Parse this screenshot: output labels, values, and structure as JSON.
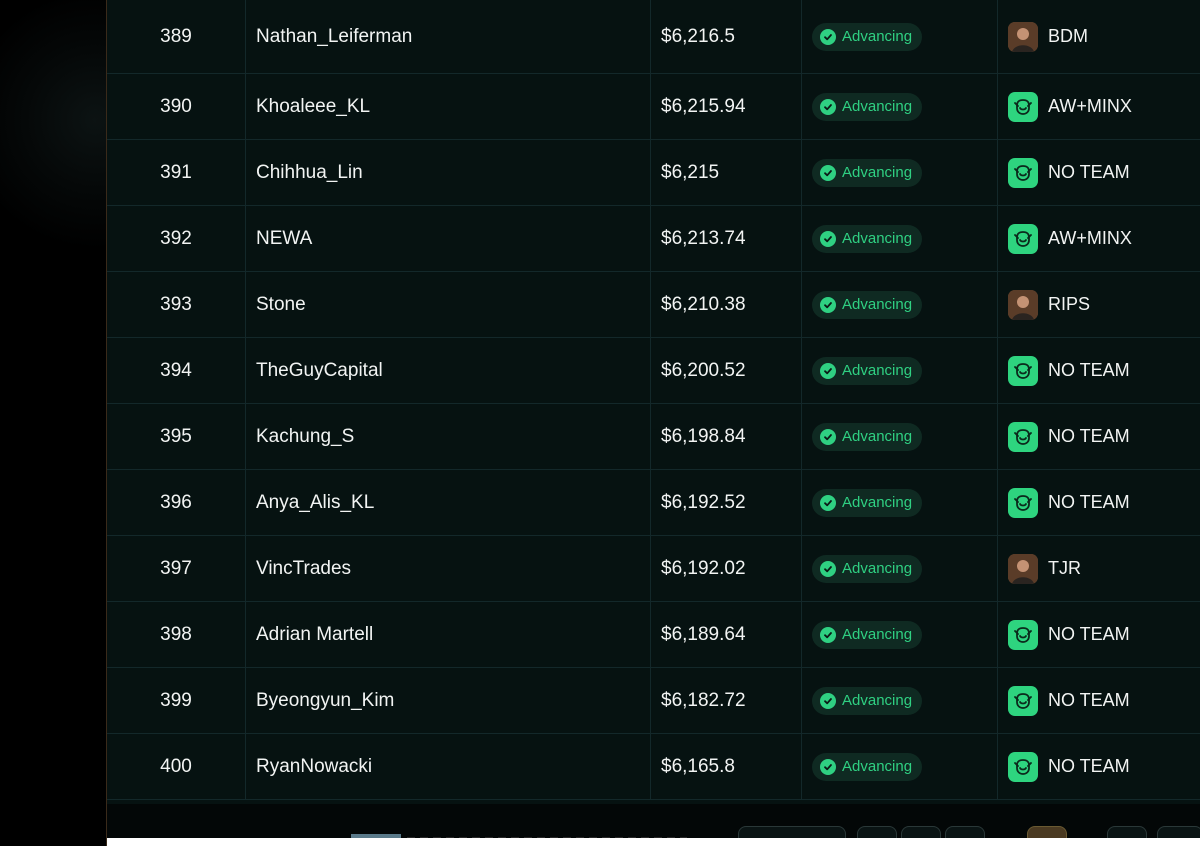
{
  "rows": [
    {
      "rank": "389",
      "name": "Nathan_Leiferman",
      "amount": "$6,216.5",
      "status": "Advancing",
      "team": "BDM",
      "team_icon": "avatar-icon"
    },
    {
      "rank": "390",
      "name": "Khoaleee_KL",
      "amount": "$6,215.94",
      "status": "Advancing",
      "team": "AW+MINX",
      "team_icon": "hand-logo-icon"
    },
    {
      "rank": "391",
      "name": "Chihhua_Lin",
      "amount": "$6,215",
      "status": "Advancing",
      "team": "NO TEAM",
      "team_icon": "hand-logo-icon"
    },
    {
      "rank": "392",
      "name": "NEWA",
      "amount": "$6,213.74",
      "status": "Advancing",
      "team": "AW+MINX",
      "team_icon": "hand-logo-icon"
    },
    {
      "rank": "393",
      "name": "Stone",
      "amount": "$6,210.38",
      "status": "Advancing",
      "team": "RIPS",
      "team_icon": "avatar-icon"
    },
    {
      "rank": "394",
      "name": "TheGuyCapital",
      "amount": "$6,200.52",
      "status": "Advancing",
      "team": "NO TEAM",
      "team_icon": "hand-logo-icon"
    },
    {
      "rank": "395",
      "name": "Kachung_S",
      "amount": "$6,198.84",
      "status": "Advancing",
      "team": "NO TEAM",
      "team_icon": "hand-logo-icon"
    },
    {
      "rank": "396",
      "name": "Anya_Alis_KL",
      "amount": "$6,192.52",
      "status": "Advancing",
      "team": "NO TEAM",
      "team_icon": "hand-logo-icon"
    },
    {
      "rank": "397",
      "name": "VincTrades",
      "amount": "$6,192.02",
      "status": "Advancing",
      "team": "TJR",
      "team_icon": "avatar-icon"
    },
    {
      "rank": "398",
      "name": "Adrian Martell",
      "amount": "$6,189.64",
      "status": "Advancing",
      "team": "NO TEAM",
      "team_icon": "hand-logo-icon"
    },
    {
      "rank": "399",
      "name": "Byeongyun_Kim",
      "amount": "$6,182.72",
      "status": "Advancing",
      "team": "NO TEAM",
      "team_icon": "hand-logo-icon"
    },
    {
      "rank": "400",
      "name": "RyanNowacki",
      "amount": "$6,165.8",
      "status": "Advancing",
      "team": "NO TEAM",
      "team_icon": "hand-logo-icon"
    }
  ],
  "colors": {
    "accent": "#2fd082",
    "row_bg": "#061211",
    "badge_bg": "#0f2a22",
    "logo_bg": "#2ed47f"
  }
}
